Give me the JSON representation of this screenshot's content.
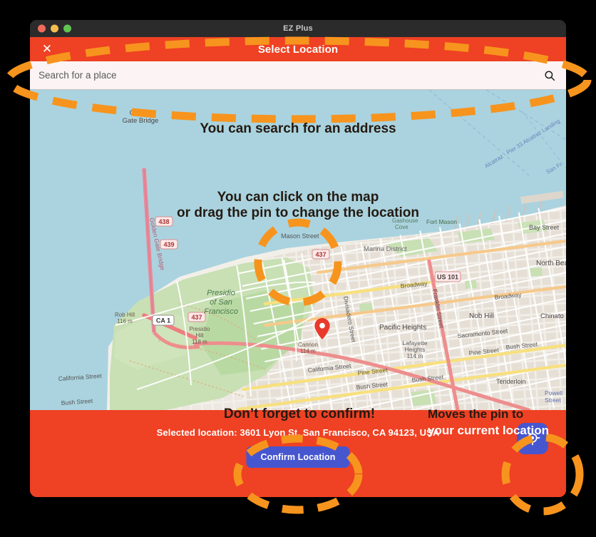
{
  "window": {
    "title": "EZ Plus",
    "traffic_lights": [
      "close",
      "minimize",
      "zoom"
    ]
  },
  "app_header": {
    "close_label": "✕",
    "title": "Select Location"
  },
  "search": {
    "placeholder": "Search for a place",
    "value": "",
    "icon": "search-icon"
  },
  "map": {
    "provider_style": "openstreetmap",
    "pin_icon": "location-pin-icon",
    "water_color": "#aad3df",
    "land_color": "#f2efe9",
    "park_color": "#c8e0b4",
    "labels": [
      "Golden Gate Bridge",
      "Golden Gate Bridge",
      "Mason Street",
      "Mason Street",
      "Marina District",
      "Presidio of San Francisco",
      "Presidio Hill 118 m",
      "Rob Hill 116 m",
      "Pacific Heights",
      "Lafayette Heights 114 m",
      "Divisadero Street",
      "Franklin Street",
      "Broadway",
      "Broadway",
      "California Street",
      "California Street",
      "Pine Street",
      "Pine Street",
      "Bush Street",
      "Bush Street",
      "Sacramento Street",
      "Bay Street",
      "North Beach",
      "Nob Hill",
      "Chinatown",
      "Tenderloin",
      "Powell Street",
      "Fort Mason",
      "Gashouse Cove",
      "Alcatraz · Pier 33 Alcatraz Landing",
      "San Fr",
      "Cannon 114 m",
      "US 101",
      "CA 1",
      "437",
      "439",
      "438"
    ],
    "shields": [
      "US 101",
      "CA 1",
      "437",
      "439",
      "438"
    ]
  },
  "footer": {
    "selected_location": "Selected location: 3601 Lyon St, San Francisco, CA 94123, USA",
    "confirm_label": "Confirm Location",
    "geolocate_icon": "my-location-icon"
  },
  "annotations": {
    "accent_color": "#f7941e",
    "text_color": "#241a12",
    "items": [
      {
        "id": "search",
        "text": "You can search for an address"
      },
      {
        "id": "click",
        "text": "You can click on the map\nor drag the pin to change the location"
      },
      {
        "id": "confirm",
        "text": "Don’t forget to confirm!"
      },
      {
        "id": "moves-1",
        "text": "Moves the pin to"
      },
      {
        "id": "moves-2",
        "text": "your current location"
      }
    ]
  },
  "colors": {
    "brand_orange": "#ef4123",
    "accent_orange": "#f7941e",
    "button_blue": "#4656cf",
    "titlebar": "#2b2b2b"
  }
}
